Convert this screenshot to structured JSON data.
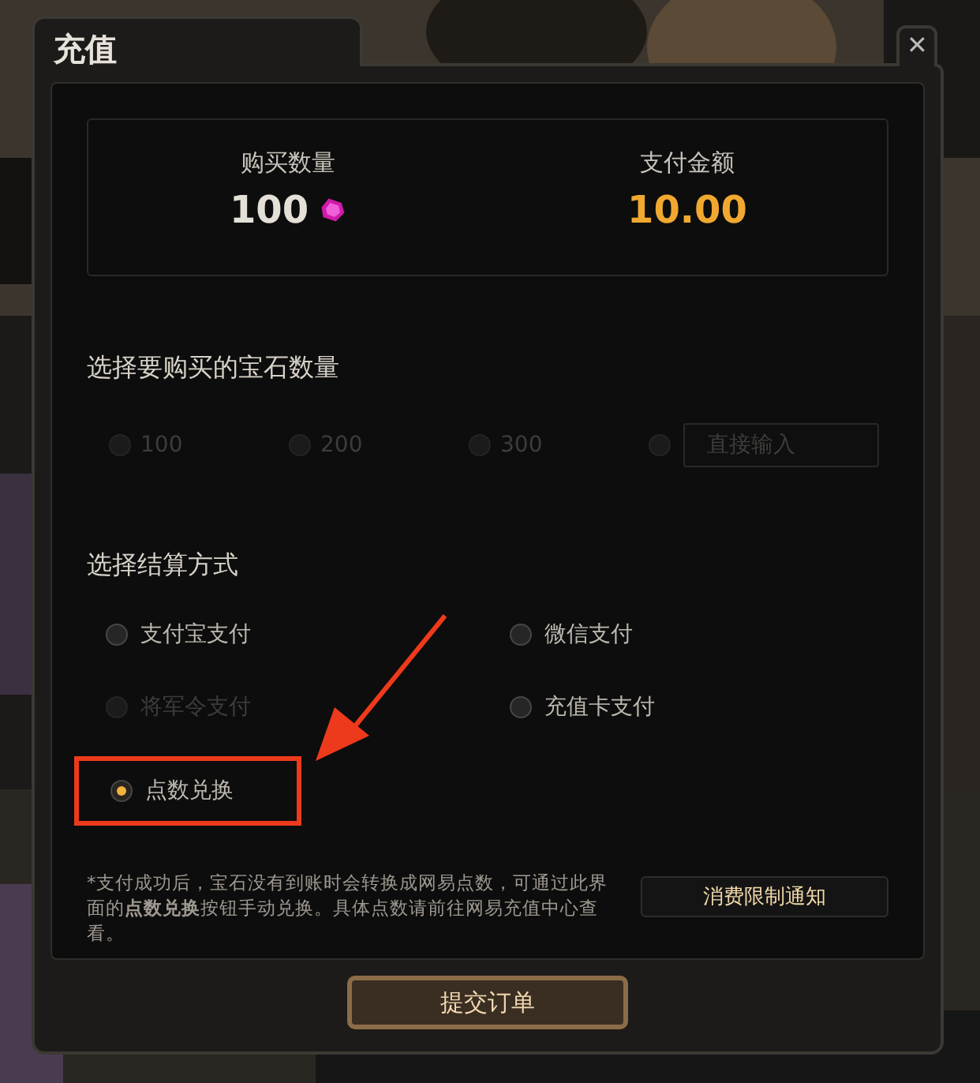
{
  "window": {
    "title": "充值",
    "close": "✕"
  },
  "summary": {
    "quantity_label": "购买数量",
    "quantity": "100",
    "amount_label": "支付金额",
    "amount": "10.00"
  },
  "quantity_section": {
    "heading": "选择要购买的宝石数量",
    "options": [
      {
        "label": "100",
        "selected": false,
        "disabled": true
      },
      {
        "label": "200",
        "selected": false,
        "disabled": true
      },
      {
        "label": "300",
        "selected": false,
        "disabled": true
      }
    ],
    "custom": {
      "placeholder": "直接输入",
      "selected": false,
      "disabled": true
    }
  },
  "payment_section": {
    "heading": "选择结算方式",
    "options": [
      {
        "label": "支付宝支付",
        "selected": false,
        "disabled": false,
        "highlighted": false
      },
      {
        "label": "微信支付",
        "selected": false,
        "disabled": false,
        "highlighted": false
      },
      {
        "label": "将军令支付",
        "selected": false,
        "disabled": true,
        "highlighted": false
      },
      {
        "label": "充值卡支付",
        "selected": false,
        "disabled": false,
        "highlighted": false
      },
      {
        "label": "点数兑换",
        "selected": true,
        "disabled": false,
        "highlighted": true
      }
    ]
  },
  "note": "*支付成功后，宝石没有到账时会转换成网易点数，可通过此界面的**点数兑换**按钮手动兑换。具体点数请前往网易充值中心查看。",
  "limit_button": "消费限制通知",
  "submit_button": "提交订单"
}
